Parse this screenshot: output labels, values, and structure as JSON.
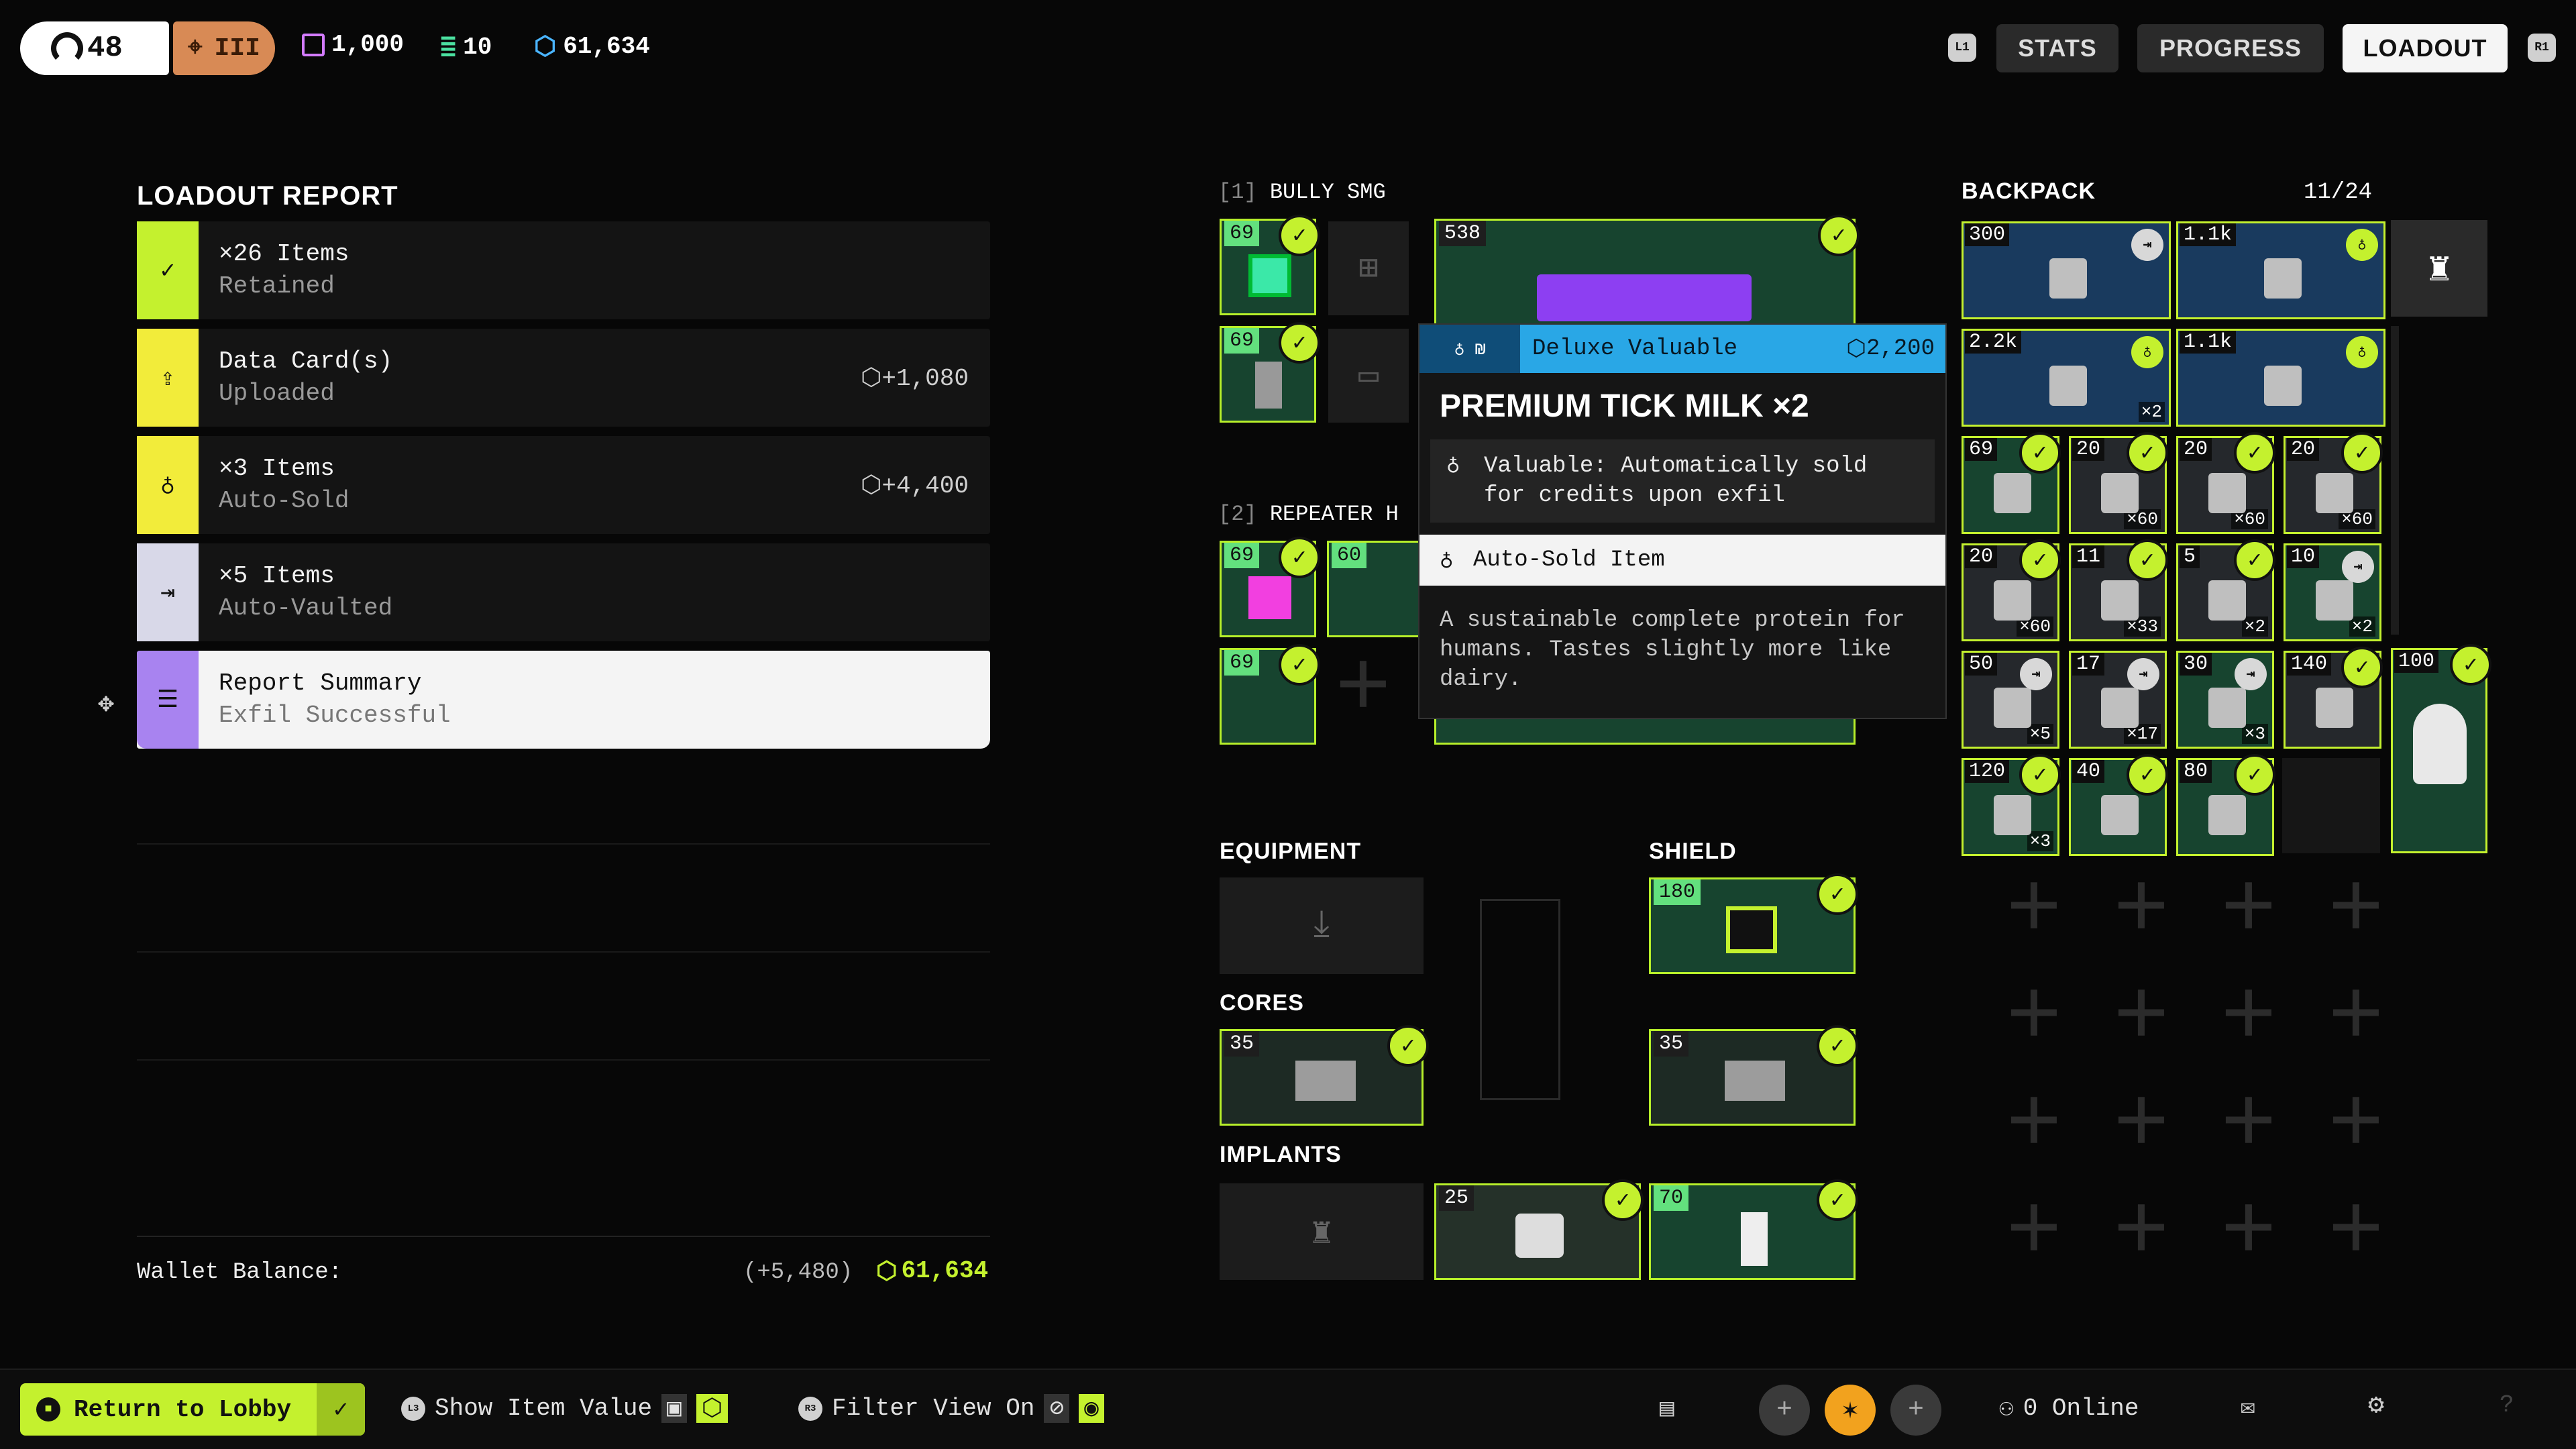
{
  "topbar": {
    "level": "48",
    "rank_glyph": "III",
    "currencies": [
      {
        "icon": "data-icon",
        "value": "1,000",
        "color": "#d37bff"
      },
      {
        "icon": "stack-icon",
        "value": "10",
        "color": "#4be0a0"
      },
      {
        "icon": "credits-icon",
        "value": "61,634",
        "color": "#4ab5ff"
      }
    ],
    "tabs": [
      "STATS",
      "PROGRESS",
      "LOADOUT"
    ],
    "active_tab": "LOADOUT",
    "l1": "L1",
    "r1": "R1"
  },
  "report": {
    "title": "LOADOUT REPORT",
    "rows": [
      {
        "line1": "×26 Items",
        "line2": "Retained",
        "value": "",
        "color": "#c4f12e",
        "icon": "check-icon"
      },
      {
        "line1": "Data Card(s)",
        "line2": "Uploaded",
        "value": "+1,080",
        "color": "#f2ec3a",
        "icon": "upload-icon"
      },
      {
        "line1": "×3 Items",
        "line2": "Auto-Sold",
        "value": "+4,400",
        "color": "#f2ec3a",
        "icon": "coin-icon"
      },
      {
        "line1": "×5 Items",
        "line2": "Auto-Vaulted",
        "value": "",
        "color": "#d8d8e8",
        "icon": "vault-icon"
      },
      {
        "line1": "Report Summary",
        "line2": "Exfil Successful",
        "value": "",
        "color": "#a883f0",
        "icon": "list-icon"
      }
    ],
    "wallet_label": "Wallet Balance:",
    "wallet_delta": "(+5,480)",
    "wallet_total": "61,634"
  },
  "weapons": {
    "w1_index": "[1]",
    "w1_name": "BULLY SMG",
    "w1_main_price": "538",
    "w1_a1": "69",
    "w1_a2": "69",
    "w2_index": "[2]",
    "w2_name": "REPEATER H",
    "w2_a1": "69",
    "w2_a2": "60",
    "w2_a3": "69"
  },
  "tooltip": {
    "tag": "Deluxe Valuable",
    "price": "2,200",
    "title": "PREMIUM TICK MILK ×2",
    "valuable": "Valuable: Automatically sold for credits upon exfil",
    "auto": "Auto-Sold Item",
    "desc": "A sustainable complete protein for humans. Tastes slightly more like dairy."
  },
  "equipment": {
    "label": "EQUIPMENT",
    "shield_label": "SHIELD",
    "shield_price": "180",
    "cores_label": "CORES",
    "core1": "35",
    "core2": "35",
    "implants_label": "IMPLANTS",
    "imp1": "25",
    "imp2": "70"
  },
  "backpack": {
    "label": "BACKPACK",
    "count": "11/24",
    "items": [
      {
        "price": "300",
        "qty": "",
        "style": "blue",
        "badge": "vault"
      },
      {
        "price": "1.1k",
        "qty": "",
        "style": "blue",
        "badge": "sold"
      },
      {
        "price": "2.2k",
        "qty": "×2",
        "style": "blue",
        "badge": "sold"
      },
      {
        "price": "1.1k",
        "qty": "",
        "style": "blue",
        "badge": "sold"
      },
      {
        "price": "69",
        "qty": "",
        "style": "teal",
        "badge": "check"
      },
      {
        "price": "20",
        "qty": "×60",
        "style": "grey",
        "badge": "check"
      },
      {
        "price": "20",
        "qty": "×60",
        "style": "grey",
        "badge": "check"
      },
      {
        "price": "20",
        "qty": "×60",
        "style": "grey",
        "badge": "check"
      },
      {
        "price": "20",
        "qty": "×60",
        "style": "grey",
        "badge": "check"
      },
      {
        "price": "11",
        "qty": "×33",
        "style": "grey",
        "badge": "check"
      },
      {
        "price": "5",
        "qty": "×2",
        "style": "grey",
        "badge": "check"
      },
      {
        "price": "10",
        "qty": "×2",
        "style": "teal",
        "badge": "vault"
      },
      {
        "price": "50",
        "qty": "×5",
        "style": "grey",
        "badge": "vault"
      },
      {
        "price": "17",
        "qty": "×17",
        "style": "grey",
        "badge": "vault"
      },
      {
        "price": "30",
        "qty": "×3",
        "style": "teal",
        "badge": "vault"
      },
      {
        "price": "140",
        "qty": "",
        "style": "grey",
        "badge": "check"
      },
      {
        "price": "120",
        "qty": "×3",
        "style": "teal",
        "badge": "check"
      },
      {
        "price": "40",
        "qty": "",
        "style": "teal",
        "badge": "check"
      },
      {
        "price": "80",
        "qty": "",
        "style": "teal",
        "badge": "check"
      }
    ],
    "side_price": "100"
  },
  "bottom": {
    "return": "Return to Lobby",
    "show_value": "Show Item Value",
    "filter": "Filter View On",
    "online": "0 Online",
    "l3": "L3",
    "r3": "R3"
  }
}
